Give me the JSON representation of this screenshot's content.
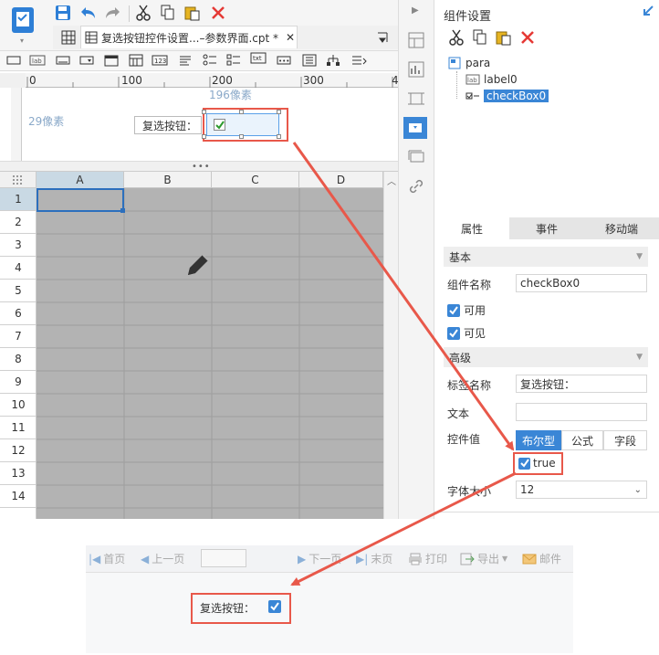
{
  "toolbar": {
    "tab_title": "复选按钮控件设置...–参数界面.cpt *"
  },
  "ruler": {
    "ticks": [
      "0",
      "100",
      "200",
      "300",
      "4"
    ],
    "width_hint": "196像素",
    "height_hint": "29像素"
  },
  "param_panel": {
    "label_text": "复选按钮："
  },
  "grid": {
    "columns": [
      "A",
      "B",
      "C",
      "D"
    ],
    "rows": [
      "1",
      "2",
      "3",
      "4",
      "5",
      "6",
      "7",
      "8",
      "9",
      "10",
      "11",
      "12",
      "13",
      "14"
    ]
  },
  "right_panel": {
    "title": "组件设置",
    "tree": {
      "root": "para",
      "children": [
        "label0",
        "checkBox0"
      ]
    },
    "tabs": [
      "属性",
      "事件",
      "移动端"
    ],
    "sections": {
      "basic": "基本",
      "advanced": "高级"
    },
    "fields": {
      "component_name_label": "组件名称",
      "component_name_value": "checkBox0",
      "enabled_label": "可用",
      "visible_label": "可见",
      "tag_name_label": "标签名称",
      "tag_name_value": "复选按钮：",
      "text_label": "文本",
      "text_value": "",
      "control_value_label": "控件值",
      "value_types": [
        "布尔型",
        "公式",
        "字段"
      ],
      "bool_value": "true",
      "font_size_label": "字体大小",
      "font_size_value": "12"
    }
  },
  "preview": {
    "nav": {
      "first": "首页",
      "prev": "上一页",
      "next": "下一页",
      "last": "末页",
      "print": "打印",
      "export": "导出",
      "mail": "邮件"
    },
    "label_text": "复选按钮："
  },
  "colors": {
    "accent": "#3a86d6",
    "highlight_border": "#e8584a",
    "arrow": "#e8584a",
    "grid_bg": "#b3b3b3"
  }
}
